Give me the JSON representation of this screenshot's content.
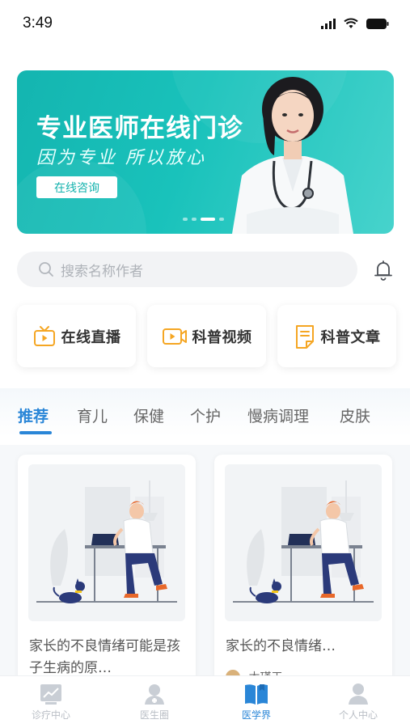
{
  "status_bar": {
    "time": "3:49"
  },
  "banner": {
    "title": "专业医师在线门诊",
    "subtitle": "因为专业 所以放心",
    "button_label": "在线咨询",
    "slide_count": 4,
    "active_slide": 3
  },
  "search": {
    "placeholder": "搜索名称作者"
  },
  "quick_links": [
    {
      "label": "在线直播",
      "icon": "tv-live-icon"
    },
    {
      "label": "科普视频",
      "icon": "video-play-icon"
    },
    {
      "label": "科普文章",
      "icon": "article-icon"
    }
  ],
  "category_tabs": [
    {
      "label": "推荐",
      "active": true
    },
    {
      "label": "育儿",
      "active": false
    },
    {
      "label": "保健",
      "active": false
    },
    {
      "label": "个护",
      "active": false
    },
    {
      "label": "慢病调理",
      "active": false
    },
    {
      "label": "皮肤",
      "active": false
    }
  ],
  "articles": [
    {
      "title": "家长的不良情绪可能是孩子生病的原…",
      "author": ""
    },
    {
      "title": "家长的不良情绪…",
      "author": "木瑾王"
    }
  ],
  "bottom_nav": [
    {
      "label": "诊疗中心",
      "icon": "chart-icon",
      "active": false
    },
    {
      "label": "医生圈",
      "icon": "doctor-icon",
      "active": false
    },
    {
      "label": "医学界",
      "icon": "book-icon",
      "active": true
    },
    {
      "label": "个人中心",
      "icon": "user-icon",
      "active": false
    }
  ],
  "colors": {
    "accent": "#2a86d7",
    "banner": "#19c2bb",
    "icon_orange": "#f5a623"
  }
}
